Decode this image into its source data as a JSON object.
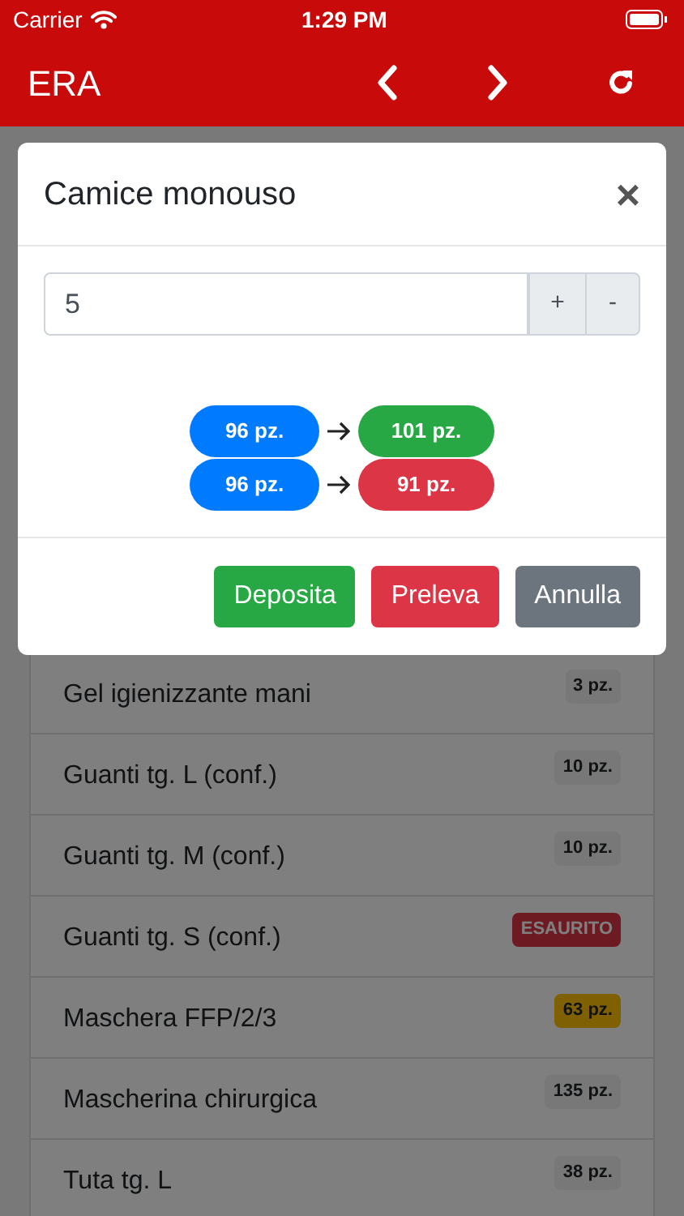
{
  "status_bar": {
    "carrier": "Carrier",
    "time": "1:29 PM"
  },
  "nav_bar": {
    "title": "ERA"
  },
  "modal": {
    "title": "Camice monouso",
    "close": "×",
    "quantity": {
      "value": "5",
      "buttons": [
        "+",
        "-"
      ]
    },
    "transitions": [
      {
        "kind": "deposit",
        "from": "96 pz.",
        "to": "101 pz."
      },
      {
        "kind": "withdraw",
        "from": "96 pz.",
        "to": "91 pz."
      }
    ],
    "buttons": [
      {
        "kind": "success",
        "label": "Deposita"
      },
      {
        "kind": "danger",
        "label": "Preleva"
      },
      {
        "kind": "secondary",
        "label": "Annulla"
      }
    ]
  },
  "items": [
    {
      "name": "Gel igienizzante mani",
      "badge": {
        "kind": "light",
        "text": "3 pz."
      }
    },
    {
      "name": "Guanti tg. L (conf.)",
      "badge": {
        "kind": "light",
        "text": "10 pz."
      }
    },
    {
      "name": "Guanti tg. M (conf.)",
      "badge": {
        "kind": "light",
        "text": "10 pz."
      }
    },
    {
      "name": "Guanti tg. S (conf.)",
      "badge": {
        "kind": "danger",
        "text": "ESAURITO"
      }
    },
    {
      "name": "Maschera FFP/2/3",
      "badge": {
        "kind": "warning",
        "text": "63 pz."
      }
    },
    {
      "name": "Mascherina chirurgica",
      "badge": {
        "kind": "light",
        "text": "135 pz."
      }
    },
    {
      "name": "Tuta tg. L",
      "badge": {
        "kind": "light",
        "text": "38 pz."
      }
    }
  ]
}
